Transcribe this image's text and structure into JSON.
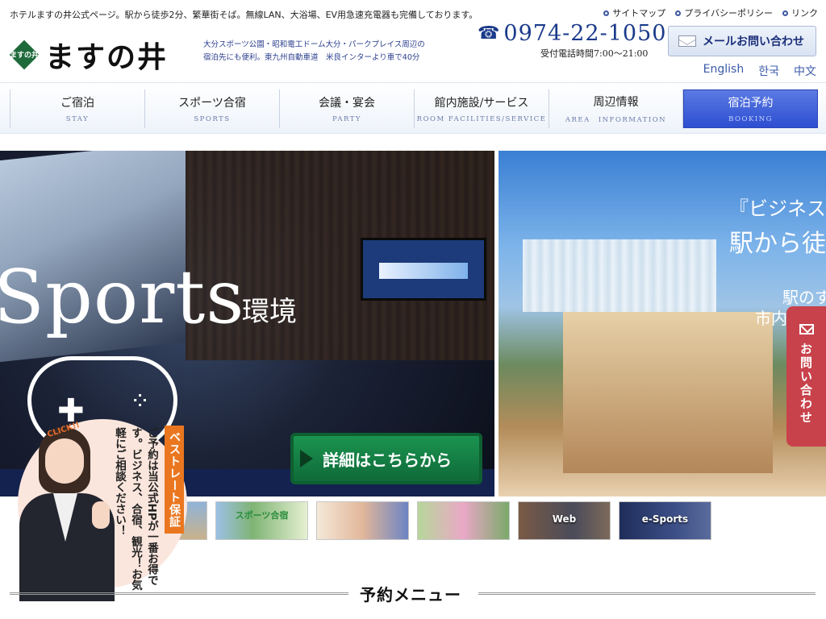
{
  "header": {
    "tagline": "ホテルますの井公式ページ。駅から徒歩2分、繁華街そば。無線LAN、大浴場、EV用急速充電器も完備しております。",
    "top_links": [
      "サイトマップ",
      "プライバシーポリシー",
      "リンク"
    ],
    "logo_mark": "ますの井",
    "logo_text": "ますの井",
    "desc_line1": "大分スポーツ公園・昭和電工ドーム大分・パークプレイス周辺の",
    "desc_line2": "宿泊先にも便利。東九州自動車道　米良インターより車で40分",
    "phone": "0974-22-1050",
    "phone_hours": "受付電話時間7:00〜21:00",
    "mail_button": "メールお問い合わせ",
    "languages": [
      "English",
      "한국",
      "中文"
    ]
  },
  "nav": [
    {
      "jp": "ご宿泊",
      "en": "STAY"
    },
    {
      "jp": "スポーツ合宿",
      "en": "SPORTS"
    },
    {
      "jp": "会議・宴会",
      "en": "PARTY"
    },
    {
      "jp": "館内施設/サービス",
      "en": "ROOM FACILITIES/SERVICE"
    },
    {
      "jp": "周辺情報",
      "en": "AREA　INFORMATION"
    },
    {
      "jp": "宿泊予約",
      "en": "BOOKING"
    }
  ],
  "hero": {
    "left_big": "Sports",
    "left_sub": "環境",
    "detail_button": "詳細はこちらから",
    "right_line1": "『ビジネス",
    "right_line2": "駅から徒",
    "right_line3": "駅のす",
    "right_line4": "市内"
  },
  "contact_tab": "お問い合わせ",
  "thumbnails": [
    {
      "caption": ""
    },
    {
      "caption": "スポーツ合宿"
    },
    {
      "caption": ""
    },
    {
      "caption": ""
    },
    {
      "caption": "Web"
    },
    {
      "caption": "e-Sports"
    }
  ],
  "promo": {
    "click": "CLICK!!",
    "best_rate": "ベストレート保証",
    "copy": "ご予約は当公式HPが一番お得です。ビジネス、合宿、観光！お気軽にご相談ください！"
  },
  "section_title": "予約メニュー"
}
